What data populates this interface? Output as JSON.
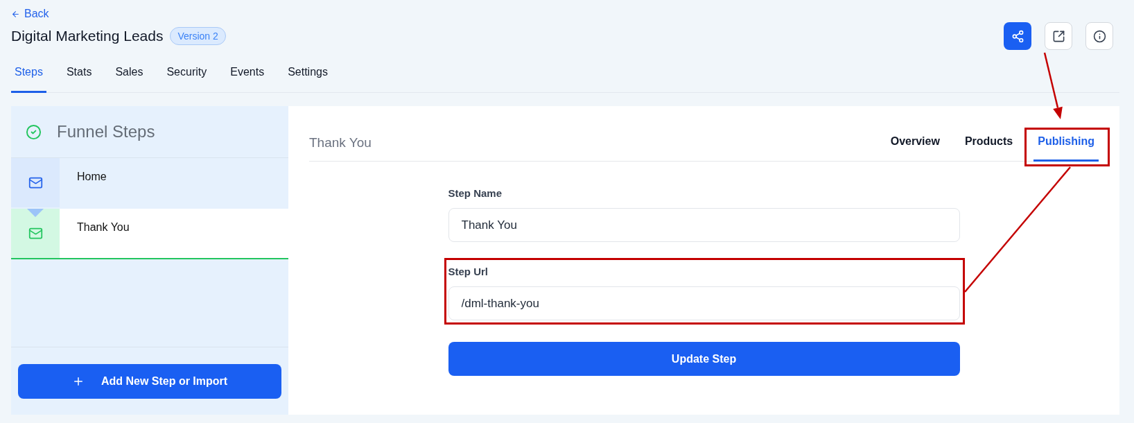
{
  "header": {
    "back_link": "Back",
    "title": "Digital Marketing Leads",
    "version_badge": "Version 2",
    "actions": [
      {
        "kind": "share",
        "primary": true
      },
      {
        "kind": "external-link",
        "primary": false
      },
      {
        "kind": "info",
        "primary": false
      }
    ]
  },
  "tabs": [
    {
      "label": "Steps",
      "selected": true
    },
    {
      "label": "Stats",
      "selected": false
    },
    {
      "label": "Sales",
      "selected": false
    },
    {
      "label": "Security",
      "selected": false
    },
    {
      "label": "Events",
      "selected": false
    },
    {
      "label": "Settings",
      "selected": false
    }
  ],
  "funnel_steps": {
    "title": "Funnel Steps",
    "items": [
      {
        "name": "Home",
        "selected": false
      },
      {
        "name": "Thank You",
        "selected": true
      }
    ],
    "add_button": "Add New Step or Import"
  },
  "step_panel": {
    "title": "Thank You",
    "tabs": [
      {
        "label": "Overview",
        "selected": false,
        "highlighted": false
      },
      {
        "label": "Products",
        "selected": false,
        "highlighted": false
      },
      {
        "label": "Publishing",
        "selected": true,
        "highlighted": true
      }
    ],
    "fields": [
      {
        "label": "Step Name",
        "value": "Thank You",
        "highlighted": false
      },
      {
        "label": "Step Url",
        "value": "/dml-thank-you",
        "highlighted": true
      }
    ],
    "submit_button": "Update Step"
  },
  "annotation_lines": [
    {
      "kind": "arrow"
    },
    {
      "kind": "line"
    }
  ]
}
